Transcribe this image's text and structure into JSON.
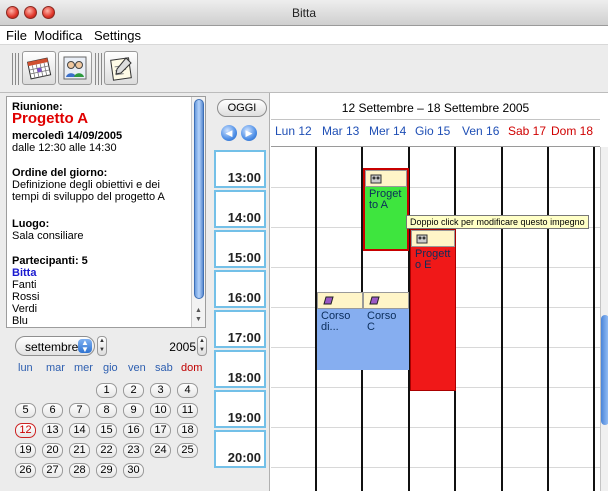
{
  "window": {
    "title": "Bitta"
  },
  "menu": [
    "File",
    "Modifica",
    "Settings"
  ],
  "toolbar": {
    "icons": [
      "calendar-icon",
      "people-icon",
      "notepad-icon"
    ]
  },
  "appointment": {
    "heading": "Riunione:",
    "title": "Progetto A",
    "date": "mercoledì 14/09/2005",
    "time": "dalle 12:30 alle 14:30",
    "agenda_label": "Ordine del giorno:",
    "agenda_line1": "Definizione degli obiettivi e dei",
    "agenda_line2": "tempi di sviluppo del progetto A",
    "place_label": "Luogo:",
    "place": "Sala consiliare",
    "participants_label": "Partecipanti: 5",
    "participants": [
      "Bitta",
      "Fanti",
      "Rossi",
      "Verdi",
      "Blu"
    ]
  },
  "mini_calendar": {
    "month": "settembre",
    "year": "2005",
    "weekdays": [
      "lun",
      "mar",
      "mer",
      "gio",
      "ven",
      "sab",
      "dom"
    ],
    "days": [
      "1",
      "2",
      "3",
      "4",
      "5",
      "6",
      "7",
      "8",
      "9",
      "10",
      "11",
      "12",
      "13",
      "14",
      "15",
      "16",
      "17",
      "18",
      "19",
      "20",
      "21",
      "22",
      "23",
      "24",
      "25",
      "26",
      "27",
      "28",
      "29",
      "30"
    ],
    "today": "12"
  },
  "week_view": {
    "today_button": "OGGI",
    "range": "12 Settembre – 18 Settembre 2005",
    "days": [
      "Lun 12",
      "Mar 13",
      "Mer 14",
      "Gio 15",
      "Ven 16",
      "Sab 17",
      "Dom 18"
    ],
    "hours": [
      "13:00",
      "14:00",
      "15:00",
      "16:00",
      "17:00",
      "18:00",
      "19:00",
      "20:00"
    ],
    "events": [
      {
        "label": "Proget to A",
        "color": "#3ee53e"
      },
      {
        "label": "Progett o E",
        "color": "#f01818"
      },
      {
        "label": "Corso di...",
        "color": "#86aef0"
      },
      {
        "label": "Corso C",
        "color": "#86aef0"
      }
    ],
    "tooltip": "Doppio click per modificare questo impegno"
  }
}
